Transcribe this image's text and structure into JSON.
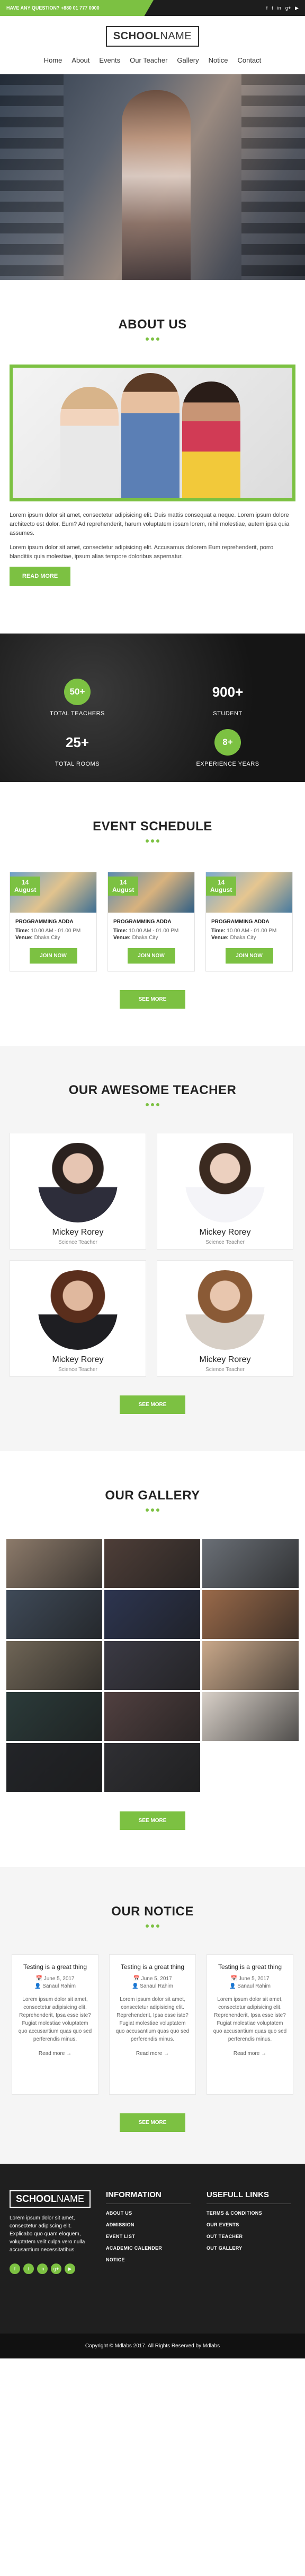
{
  "topbar": {
    "question": "HAVE ANY QUESTION? +880 01 777 0000",
    "socials": [
      "f",
      "t",
      "in",
      "g+",
      "▶"
    ]
  },
  "logo": {
    "part1": "SCHOOL",
    "part2": "NAME"
  },
  "nav": [
    "Home",
    "About",
    "Events",
    "Our Teacher",
    "Gallery",
    "Notice",
    "Contact"
  ],
  "about": {
    "title": "ABOUT US",
    "para1": "Lorem ipsum dolor sit amet, consectetur adipisicing elit. Duis mattis consequat a neque. Lorem ipsum dolore architecto est dolor. Eum? Ad reprehenderit, harum voluptatem ipsam lorem, nihil molestiae, autem ipsa quia assumes.",
    "para2": "Lorem ipsum dolor sit amet, consectetur adipisicing elit. Accusamus dolorem Eum reprehenderit, porro blanditiis quia molestiae, ipsum alias tempore doloribus aspernatur.",
    "button": "READ MORE"
  },
  "stats": [
    {
      "value": "50+",
      "label": "TOTAL TEACHERS"
    },
    {
      "value": "900+",
      "label": "STUDENT"
    },
    {
      "value": "25+",
      "label": "TOTAL ROOMS"
    },
    {
      "value": "8+",
      "label": "EXPERIENCE YEARS"
    }
  ],
  "events": {
    "title": "EVENT SCHEDULE",
    "items": [
      {
        "day": "14",
        "month": "August",
        "title": "PROGRAMMING ADDA",
        "time_label": "Time:",
        "time": "10.00 AM - 01.00 PM",
        "venue_label": "Venue:",
        "venue": "Dhaka City",
        "button": "JOIN NOW"
      },
      {
        "day": "14",
        "month": "August",
        "title": "PROGRAMMING ADDA",
        "time_label": "Time:",
        "time": "10.00 AM - 01.00 PM",
        "venue_label": "Venue:",
        "venue": "Dhaka City",
        "button": "JOIN NOW"
      },
      {
        "day": "14",
        "month": "August",
        "title": "PROGRAMMING ADDA",
        "time_label": "Time:",
        "time": "10.00 AM - 01.00 PM",
        "venue_label": "Venue:",
        "venue": "Dhaka City",
        "button": "JOIN NOW"
      }
    ],
    "more": "SEE MORE"
  },
  "teachers": {
    "title": "OUR AWESOME TEACHER",
    "items": [
      {
        "name": "Mickey Rorey",
        "role": "Science Teacher"
      },
      {
        "name": "Mickey Rorey",
        "role": "Science Teacher"
      },
      {
        "name": "Mickey Rorey",
        "role": "Science Teacher"
      },
      {
        "name": "Mickey Rorey",
        "role": "Science Teacher"
      }
    ],
    "more": "SEE MORE"
  },
  "gallery": {
    "title": "OUR GALLERY",
    "colors": [
      "#8c7a6a",
      "#4e3e38",
      "#6a6f76",
      "#3f4a58",
      "#2d3550",
      "#9a6a4a",
      "#6f6556",
      "#3b3a44",
      "#c9a88a",
      "#2b3b3a",
      "#514040",
      "#d8d0c8",
      "#222428",
      "#2f2f33"
    ],
    "more": "SEE MORE"
  },
  "notice": {
    "title": "OUR NOTICE",
    "items": [
      {
        "title": "Testing is a great thing",
        "date": "June 5, 2017",
        "author": "Sanaul Rahim",
        "desc": "Lorem ipsum dolor sit amet, consectetur adipisicing elit. Reprehenderit, Ipsa esse iste? Fugiat molestiae voluptatem quo accusantium quas quo sed perferendis minus.",
        "more": "Read more →"
      },
      {
        "title": "Testing is a great thing",
        "date": "June 5, 2017",
        "author": "Sanaul Rahim",
        "desc": "Lorem ipsum dolor sit amet, consectetur adipisicing elit. Reprehenderit, Ipsa esse iste? Fugiat molestiae voluptatem quo accusantium quas quo sed perferendis minus.",
        "more": "Read more →"
      },
      {
        "title": "Testing is a great thing",
        "date": "June 5, 2017",
        "author": "Sanaul Rahim",
        "desc": "Lorem ipsum dolor sit amet, consectetur adipisicing elit. Reprehenderit, Ipsa esse iste? Fugiat molestiae voluptatem quo accusantium quas quo sed perferendis minus.",
        "more": "Read more →"
      }
    ],
    "more": "SEE MORE"
  },
  "footer": {
    "text": "Lorem ipsum dolor sit amet, consectetur adipiscing elit. Explicabo quo quam eloquem, voluptatem velit culpa vero nulla accusantium necessitatibus.",
    "socials": [
      "f",
      "t",
      "in",
      "g+",
      "▶"
    ],
    "info_title": "INFORMATION",
    "info_links": [
      "ABOUT US",
      "ADMISSION",
      "EVENT LIST",
      "ACADEMIC CALENDER",
      "NOTICE"
    ],
    "useful_title": "USEFULL LINKS",
    "useful_links": [
      "TERMS & CONDITIONS",
      "OUR EVENTS",
      "OUT TEACHER",
      "OUT GALLERY"
    ],
    "copyright": "Copyright © Mdlabs 2017. All Rights Reserved by Mdlabs"
  }
}
